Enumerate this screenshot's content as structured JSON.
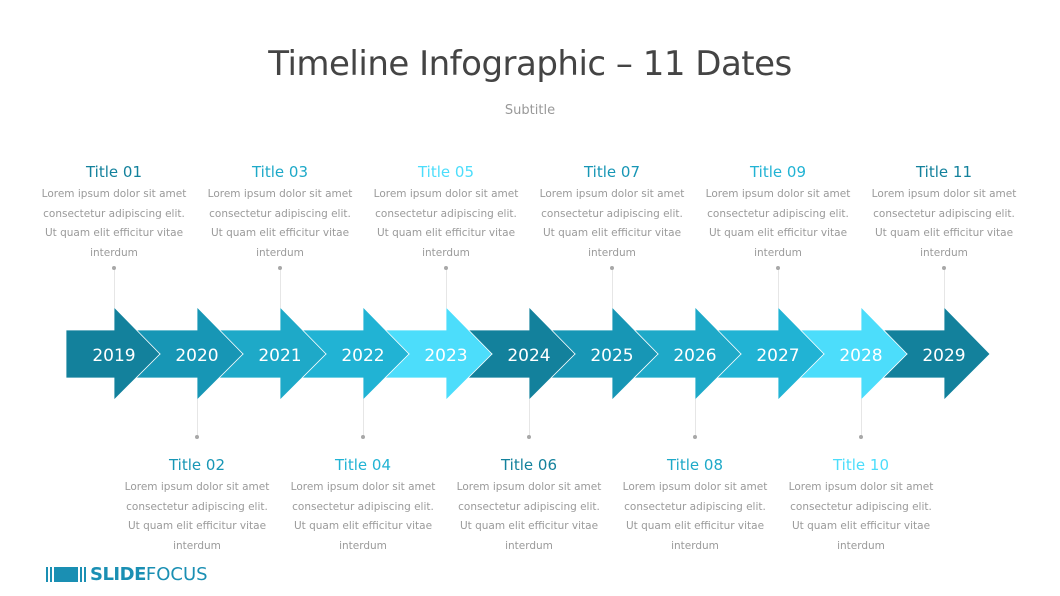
{
  "header": {
    "title": "Timeline Infographic – 11 Dates",
    "subtitle": "Subtitle"
  },
  "timeline": {
    "items": [
      {
        "year": "2019",
        "title": "Title 01",
        "position": "top",
        "color": "#13819C",
        "description": [
          "Lorem ipsum dolor sit amet",
          "consectetur adipiscing elit.",
          "Ut quam elit efficitur vitae",
          "interdum"
        ]
      },
      {
        "year": "2020",
        "title": "Title 02",
        "position": "bottom",
        "color": "#1796B5",
        "description": [
          "Lorem ipsum dolor sit amet",
          "consectetur adipiscing elit.",
          "Ut quam elit efficitur vitae",
          "interdum"
        ]
      },
      {
        "year": "2021",
        "title": "Title 03",
        "position": "top",
        "color": "#1EA9C8",
        "description": [
          "Lorem ipsum dolor sit amet",
          "consectetur adipiscing elit.",
          "Ut quam elit efficitur vitae",
          "interdum"
        ]
      },
      {
        "year": "2022",
        "title": "Title 04",
        "position": "bottom",
        "color": "#21B3D4",
        "description": [
          "Lorem ipsum dolor sit amet",
          "consectetur adipiscing elit.",
          "Ut quam elit efficitur vitae",
          "interdum"
        ]
      },
      {
        "year": "2023",
        "title": "Title 05",
        "position": "top",
        "color": "#4CDDFB",
        "description": [
          "Lorem ipsum dolor sit amet",
          "consectetur adipiscing elit.",
          "Ut quam elit efficitur vitae",
          "interdum"
        ]
      },
      {
        "year": "2024",
        "title": "Title 06",
        "position": "bottom",
        "color": "#13819C",
        "description": [
          "Lorem ipsum dolor sit amet",
          "consectetur adipiscing elit.",
          "Ut quam elit efficitur vitae",
          "interdum"
        ]
      },
      {
        "year": "2025",
        "title": "Title 07",
        "position": "top",
        "color": "#1796B5",
        "description": [
          "Lorem ipsum dolor sit amet",
          "consectetur adipiscing elit.",
          "Ut quam elit efficitur vitae",
          "interdum"
        ]
      },
      {
        "year": "2026",
        "title": "Title 08",
        "position": "bottom",
        "color": "#1EA9C8",
        "description": [
          "Lorem ipsum dolor sit amet",
          "consectetur adipiscing elit.",
          "Ut quam elit efficitur vitae",
          "interdum"
        ]
      },
      {
        "year": "2027",
        "title": "Title 09",
        "position": "top",
        "color": "#21B3D4",
        "description": [
          "Lorem ipsum dolor sit amet",
          "consectetur adipiscing elit.",
          "Ut quam elit efficitur vitae",
          "interdum"
        ]
      },
      {
        "year": "2028",
        "title": "Title 10",
        "position": "bottom",
        "color": "#4CDDFB",
        "description": [
          "Lorem ipsum dolor sit amet",
          "consectetur adipiscing elit.",
          "Ut quam elit efficitur vitae",
          "interdum"
        ]
      },
      {
        "year": "2029",
        "title": "Title 11",
        "position": "top",
        "color": "#13819C",
        "description": [
          "Lorem ipsum dolor sit amet",
          "consectetur adipiscing elit.",
          "Ut quam elit efficitur vitae",
          "interdum"
        ]
      }
    ]
  },
  "logo": {
    "bold_text": "SLIDE",
    "light_text": "FOCUS",
    "color": "#1A8FB3"
  }
}
